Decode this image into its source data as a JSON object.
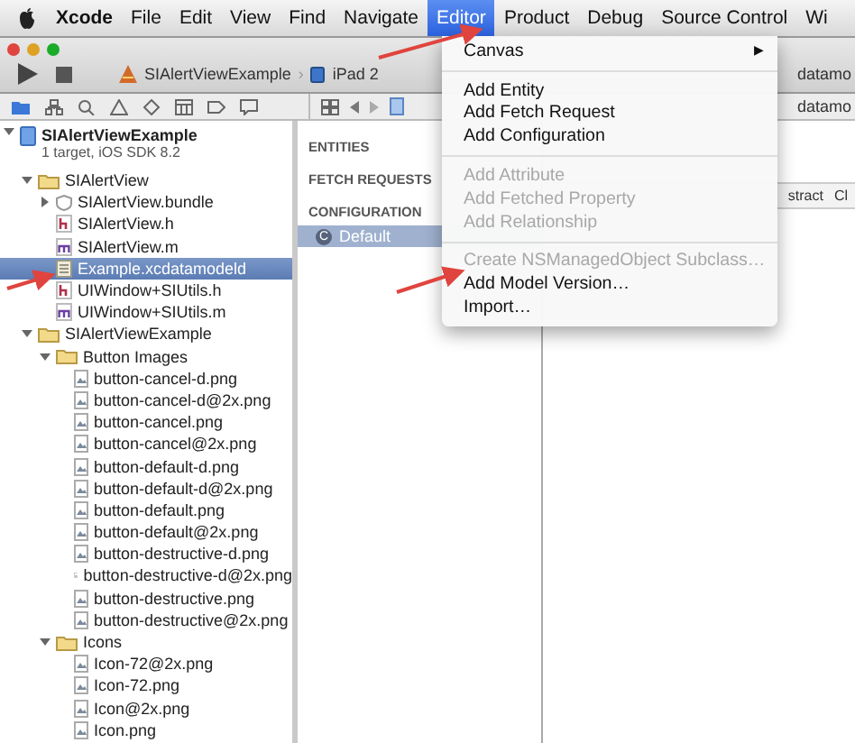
{
  "menu_bar": {
    "items": [
      {
        "label": "Xcode",
        "selected": false,
        "bold": true
      },
      {
        "label": "File",
        "selected": false
      },
      {
        "label": "Edit",
        "selected": false
      },
      {
        "label": "View",
        "selected": false
      },
      {
        "label": "Find",
        "selected": false
      },
      {
        "label": "Navigate",
        "selected": false
      },
      {
        "label": "Editor",
        "selected": true
      },
      {
        "label": "Product",
        "selected": false
      },
      {
        "label": "Debug",
        "selected": false
      },
      {
        "label": "Source Control",
        "selected": false
      },
      {
        "label": "Wi",
        "selected": false
      }
    ]
  },
  "toolbar": {
    "scheme": "SIAlertViewExample",
    "separator": "›",
    "device": "iPad 2",
    "tab_title": "datamo"
  },
  "navigator": {
    "tree": [
      {
        "kind": "project",
        "label": "SIAlertViewExample",
        "subtitle": "1 target, iOS SDK 8.2",
        "expanded": true,
        "selected": false,
        "children": [
          {
            "kind": "folder",
            "label": "SIAlertView",
            "expanded": true,
            "selected": false,
            "children": [
              {
                "kind": "bundle",
                "label": "SIAlertView.bundle",
                "expanded": false,
                "selected": false
              },
              {
                "kind": "header",
                "label": "SIAlertView.h",
                "selected": false
              },
              {
                "kind": "source",
                "label": "SIAlertView.m",
                "selected": false
              },
              {
                "kind": "datamodel",
                "label": "Example.xcdatamodeld",
                "selected": true
              },
              {
                "kind": "header",
                "label": "UIWindow+SIUtils.h",
                "selected": false
              },
              {
                "kind": "source",
                "label": "UIWindow+SIUtils.m",
                "selected": false
              }
            ]
          },
          {
            "kind": "folder",
            "label": "SIAlertViewExample",
            "expanded": true,
            "selected": false,
            "children": [
              {
                "kind": "folder",
                "label": "Button Images",
                "expanded": true,
                "selected": false,
                "children": [
                  {
                    "kind": "image",
                    "label": "button-cancel-d.png",
                    "selected": false
                  },
                  {
                    "kind": "image",
                    "label": "button-cancel-d@2x.png",
                    "selected": false
                  },
                  {
                    "kind": "image",
                    "label": "button-cancel.png",
                    "selected": false
                  },
                  {
                    "kind": "image",
                    "label": "button-cancel@2x.png",
                    "selected": false
                  },
                  {
                    "kind": "image",
                    "label": "button-default-d.png",
                    "selected": false
                  },
                  {
                    "kind": "image",
                    "label": "button-default-d@2x.png",
                    "selected": false
                  },
                  {
                    "kind": "image",
                    "label": "button-default.png",
                    "selected": false
                  },
                  {
                    "kind": "image",
                    "label": "button-default@2x.png",
                    "selected": false
                  },
                  {
                    "kind": "image",
                    "label": "button-destructive-d.png",
                    "selected": false
                  },
                  {
                    "kind": "image",
                    "label": "button-destructive-d@2x.png",
                    "selected": false
                  },
                  {
                    "kind": "image",
                    "label": "button-destructive.png",
                    "selected": false
                  },
                  {
                    "kind": "image",
                    "label": "button-destructive@2x.png",
                    "selected": false
                  }
                ]
              },
              {
                "kind": "folder",
                "label": "Icons",
                "expanded": true,
                "selected": false,
                "children": [
                  {
                    "kind": "image",
                    "label": "Icon-72@2x.png",
                    "selected": false
                  },
                  {
                    "kind": "image",
                    "label": "Icon-72.png",
                    "selected": false
                  },
                  {
                    "kind": "image",
                    "label": "Icon@2x.png",
                    "selected": false
                  },
                  {
                    "kind": "image",
                    "label": "Icon.png",
                    "selected": false
                  }
                ]
              }
            ]
          }
        ]
      }
    ]
  },
  "model_outline": {
    "jump_title": "datamo",
    "sections": [
      {
        "label": "ENTITIES"
      },
      {
        "label": "FETCH REQUESTS"
      },
      {
        "label": "CONFIGURATION",
        "items": [
          {
            "badge": "C",
            "label": "Default",
            "selected": true
          }
        ]
      }
    ]
  },
  "inspector": {
    "columns": [
      "stract",
      "Cl"
    ]
  },
  "editor_menu": {
    "items": [
      {
        "kind": "submenu",
        "label": "Canvas",
        "arrow": "▶",
        "disabled": false
      },
      {
        "kind": "separator"
      },
      {
        "kind": "item",
        "label": "Add Entity",
        "disabled": false
      },
      {
        "kind": "item",
        "label": "Add Fetch Request",
        "disabled": false
      },
      {
        "kind": "item",
        "label": "Add Configuration",
        "disabled": false
      },
      {
        "kind": "separator"
      },
      {
        "kind": "item",
        "label": "Add Attribute",
        "disabled": true
      },
      {
        "kind": "item",
        "label": "Add Fetched Property",
        "disabled": true
      },
      {
        "kind": "item",
        "label": "Add Relationship",
        "disabled": true
      },
      {
        "kind": "separator"
      },
      {
        "kind": "item",
        "label": "Create NSManagedObject Subclass…",
        "disabled": true
      },
      {
        "kind": "item",
        "label": "Add Model Version…",
        "disabled": false
      },
      {
        "kind": "item",
        "label": "Import…",
        "disabled": false
      }
    ]
  }
}
